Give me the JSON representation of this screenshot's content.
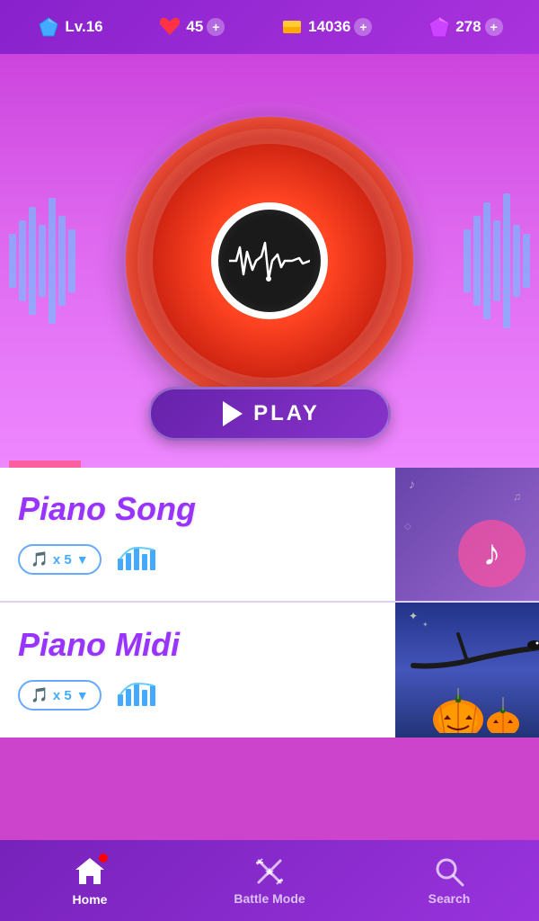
{
  "topbar": {
    "level": "Lv.16",
    "hearts": "45",
    "coins": "14036",
    "gems": "278"
  },
  "hero": {
    "play_label": "PLAY"
  },
  "songs": [
    {
      "title": "Piano Song",
      "ticket_count": "x 5",
      "theme": "piano"
    },
    {
      "title": "Piano Midi",
      "ticket_count": "x 5",
      "theme": "halloween"
    }
  ],
  "nav": {
    "home_label": "Home",
    "battle_label": "Battle Mode",
    "search_label": "Search"
  }
}
